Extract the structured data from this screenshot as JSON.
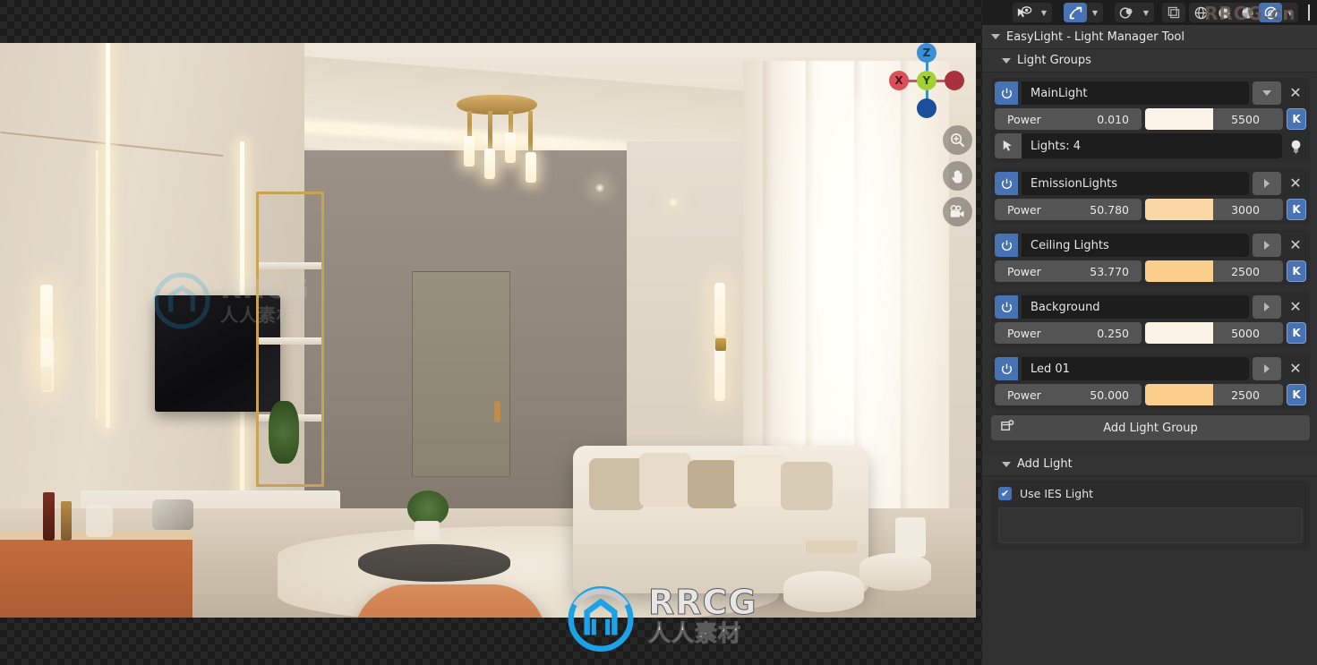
{
  "toolbar": {
    "items": [
      {
        "name": "visibility-selectability-icon",
        "glyph": "eye",
        "active": false,
        "has_chevron": true
      },
      {
        "name": "gizmo-icon",
        "glyph": "gizmo",
        "active": true,
        "has_chevron": true
      },
      {
        "name": "overlays-icon",
        "glyph": "overlays",
        "active": false,
        "has_chevron": true
      },
      {
        "name": "xray-toggle-icon",
        "glyph": "xray",
        "active": false,
        "has_chevron": false
      },
      {
        "name": "shading-wireframe-icon",
        "glyph": "wireframe",
        "active": false,
        "has_chevron": false
      },
      {
        "name": "shading-solid-icon",
        "glyph": "solid",
        "active": false,
        "has_chevron": false
      },
      {
        "name": "shading-material-icon",
        "glyph": "material",
        "active": false,
        "has_chevron": false
      },
      {
        "name": "shading-rendered-icon",
        "glyph": "rendered",
        "active": true,
        "has_chevron": true
      }
    ]
  },
  "viewport": {
    "axis_gizmo": {
      "name": "navigation-gizmo",
      "axes": [
        {
          "label": "Z",
          "color": "#3b8fd6",
          "pos": "top"
        },
        {
          "label": "Y",
          "color": "#a2d136",
          "pos": "center"
        },
        {
          "label": "X",
          "color": "#d9505b",
          "pos": "left"
        },
        {
          "label": "",
          "color": "#a8313c",
          "pos": "right"
        },
        {
          "label": "",
          "color": "#1b4f9c",
          "pos": "bottom"
        }
      ]
    },
    "nav_buttons": [
      {
        "name": "zoom-view-button",
        "icon": "magnifier-plus-icon"
      },
      {
        "name": "pan-view-button",
        "icon": "hand-icon"
      },
      {
        "name": "camera-view-button",
        "icon": "camera-icon"
      }
    ]
  },
  "panel": {
    "title": "EasyLight - Light Manager Tool",
    "sections": {
      "light_groups_label": "Light Groups",
      "add_light_label": "Add Light"
    },
    "power_label": "Power",
    "kelvin_label": "K",
    "add_light_group_label": "Add Light Group",
    "use_ies_label": "Use IES Light",
    "use_ies_checked": true,
    "groups": [
      {
        "name": "MainLight",
        "enabled": true,
        "expanded": true,
        "power": "0.010",
        "temperature": "5500",
        "swatch": "#FDF4E9",
        "lights_label": "Lights: 4"
      },
      {
        "name": "EmissionLights",
        "enabled": true,
        "expanded": false,
        "power": "50.780",
        "temperature": "3000",
        "swatch": "#FBD6A6"
      },
      {
        "name": "Ceiling Lights",
        "enabled": true,
        "expanded": false,
        "power": "53.770",
        "temperature": "2500",
        "swatch": "#FBCE8C"
      },
      {
        "name": "Background",
        "enabled": true,
        "expanded": false,
        "power": "0.250",
        "temperature": "5000",
        "swatch": "#FCF3E7"
      },
      {
        "name": "Led 01",
        "enabled": true,
        "expanded": false,
        "power": "50.000",
        "temperature": "2500",
        "swatch": "#FBCE8C"
      }
    ]
  },
  "watermarks": {
    "center": {
      "main": "RRCG",
      "sub": "人人素材"
    },
    "topbar": "RRCG.cn",
    "viewport": {
      "main": "RRCG",
      "sub": "人人素材"
    }
  },
  "colors": {
    "accent": "#4772b3",
    "panel_bg": "#303030",
    "card_bg": "#2c2c2c",
    "field_bg": "#1d1d1d",
    "slider_bg": "#545454"
  }
}
